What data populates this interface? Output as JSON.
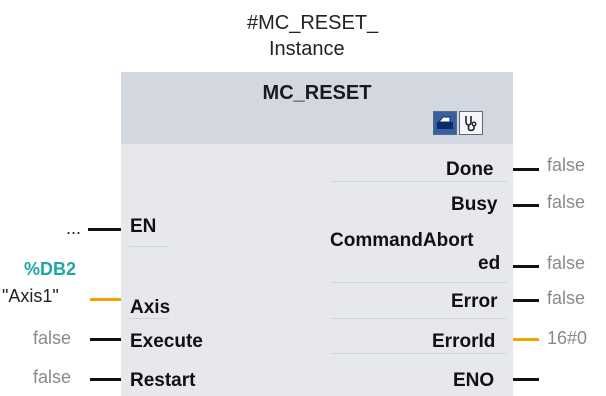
{
  "instance": {
    "line1": "#MC_RESET_",
    "line2": "Instance"
  },
  "block": {
    "title": "MC_RESET"
  },
  "inputs": {
    "en": {
      "label": "EN",
      "value": "..."
    },
    "axis": {
      "label": "Axis",
      "db": "%DB2",
      "value": "\"Axis1\""
    },
    "execute": {
      "label": "Execute",
      "value": "false"
    },
    "restart": {
      "label": "Restart",
      "value": "false"
    }
  },
  "outputs": {
    "done": {
      "label": "Done",
      "value": "false"
    },
    "busy": {
      "label": "Busy",
      "value": "false"
    },
    "command_aborted": {
      "label_line1": "CommandAbort",
      "label_line2": "ed",
      "value": "false"
    },
    "error": {
      "label": "Error",
      "value": "false"
    },
    "errorid": {
      "label": "ErrorId",
      "value": "16#0"
    },
    "eno": {
      "label": "ENO",
      "value": ""
    }
  },
  "colors": {
    "wire": "#111111",
    "typed_wire": "#f4a300",
    "db_text": "#1fa6a6",
    "value_text": "#8a8a8a"
  },
  "icons": {
    "header_left": "block-icon",
    "header_right": "diagnostics-icon"
  }
}
